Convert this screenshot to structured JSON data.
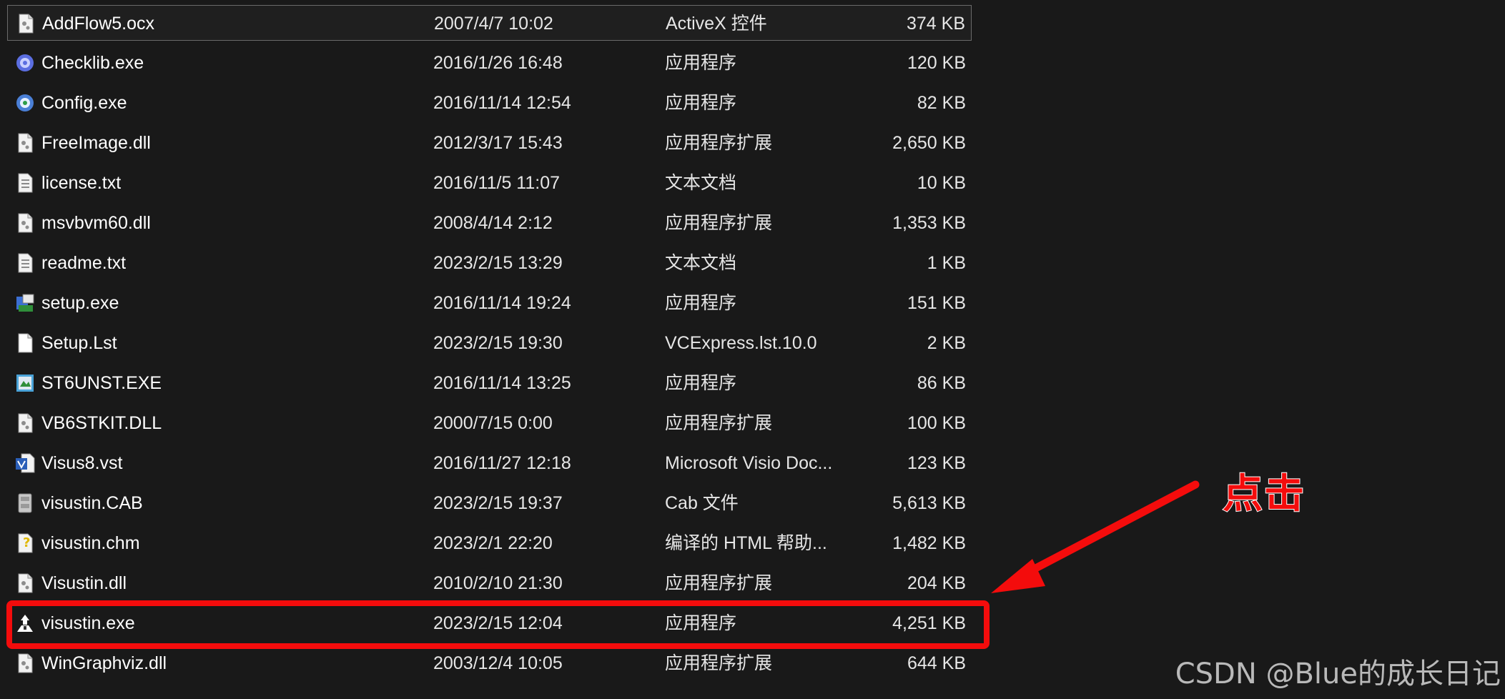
{
  "files": [
    {
      "name": "AddFlow5.ocx",
      "date": "2007/4/7 10:02",
      "type": "ActiveX 控件",
      "size": "374 KB",
      "icon": "dll-icon"
    },
    {
      "name": "Checklib.exe",
      "date": "2016/1/26 16:48",
      "type": "应用程序",
      "size": "120 KB",
      "icon": "gear-app-icon"
    },
    {
      "name": "Config.exe",
      "date": "2016/11/14 12:54",
      "type": "应用程序",
      "size": "82 KB",
      "icon": "gear-app-icon"
    },
    {
      "name": "FreeImage.dll",
      "date": "2012/3/17 15:43",
      "type": "应用程序扩展",
      "size": "2,650 KB",
      "icon": "dll-icon"
    },
    {
      "name": "license.txt",
      "date": "2016/11/5 11:07",
      "type": "文本文档",
      "size": "10 KB",
      "icon": "text-file-icon"
    },
    {
      "name": "msvbvm60.dll",
      "date": "2008/4/14 2:12",
      "type": "应用程序扩展",
      "size": "1,353 KB",
      "icon": "dll-icon"
    },
    {
      "name": "readme.txt",
      "date": "2023/2/15 13:29",
      "type": "文本文档",
      "size": "1 KB",
      "icon": "text-file-icon"
    },
    {
      "name": "setup.exe",
      "date": "2016/11/14 19:24",
      "type": "应用程序",
      "size": "151 KB",
      "icon": "setup-icon"
    },
    {
      "name": "Setup.Lst",
      "date": "2023/2/15 19:30",
      "type": "VCExpress.lst.10.0",
      "size": "2 KB",
      "icon": "blank-file-icon"
    },
    {
      "name": "ST6UNST.EXE",
      "date": "2016/11/14 13:25",
      "type": "应用程序",
      "size": "86 KB",
      "icon": "uninstall-icon"
    },
    {
      "name": "VB6STKIT.DLL",
      "date": "2000/7/15 0:00",
      "type": "应用程序扩展",
      "size": "100 KB",
      "icon": "dll-icon"
    },
    {
      "name": "Visus8.vst",
      "date": "2016/11/27 12:18",
      "type": "Microsoft Visio Doc...",
      "size": "123 KB",
      "icon": "visio-icon"
    },
    {
      "name": "visustin.CAB",
      "date": "2023/2/15 19:37",
      "type": "Cab 文件",
      "size": "5,613 KB",
      "icon": "cabinet-icon"
    },
    {
      "name": "visustin.chm",
      "date": "2023/2/1 22:20",
      "type": "编译的 HTML 帮助...",
      "size": "1,482 KB",
      "icon": "help-file-icon"
    },
    {
      "name": "Visustin.dll",
      "date": "2010/2/10 21:30",
      "type": "应用程序扩展",
      "size": "204 KB",
      "icon": "dll-icon"
    },
    {
      "name": "visustin.exe",
      "date": "2023/2/15 12:04",
      "type": "应用程序",
      "size": "4,251 KB",
      "icon": "visustin-app-icon"
    },
    {
      "name": "WinGraphviz.dll",
      "date": "2003/12/4 10:05",
      "type": "应用程序扩展",
      "size": "644 KB",
      "icon": "dll-icon"
    }
  ],
  "annotation": {
    "label": "点击",
    "color": "#f40c0c"
  },
  "watermark": "CSDN @Blue的成长日记"
}
